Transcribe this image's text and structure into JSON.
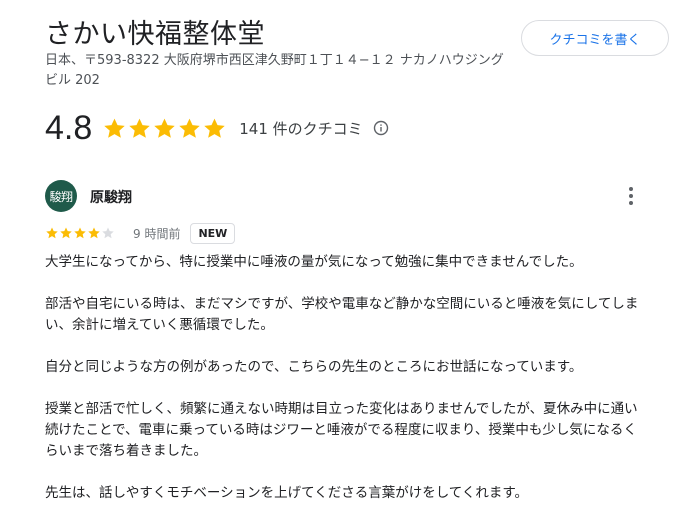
{
  "business": {
    "name": "さかい快福整体堂",
    "address": "日本、〒593-8322 大阪府堺市西区津久野町１丁１４−１２ ナカノハウジングビル 202",
    "write_review_label": "クチコミを書く"
  },
  "rating": {
    "value": "4.8",
    "stars": 4.8,
    "count_label": "141 件のクチコミ",
    "star_color": "#fbbc04"
  },
  "review": {
    "avatar_text": "駿翔",
    "avatar_color": "#1f5a4a",
    "reviewer_name": "原駿翔",
    "stars": 4,
    "time_ago": "9 時間前",
    "badge": "NEW",
    "paragraphs": [
      "大学生になってから、特に授業中に唾液の量が気になって勉強に集中できませんでした。",
      "部活や自宅にいる時は、まだマシですが、学校や電車など静かな空間にいると唾液を気にしてしまい、余計に増えていく悪循環でした。",
      "自分と同じような方の例があったので、こちらの先生のところにお世話になっています。",
      "授業と部活で忙しく、頻繁に通えない時期は目立った変化はありませんでしたが、夏休み中に通い続けたことで、電車に乗っている時はジワーと唾液がでる程度に収まり、授業中も少し気になるくらいまで落ち着きました。",
      "先生は、話しやすくモチベーションを上げてくださる言葉がけをしてくれます。"
    ]
  },
  "icons": {
    "info": "info-icon",
    "more": "more-vert-icon",
    "star": "star-icon"
  }
}
